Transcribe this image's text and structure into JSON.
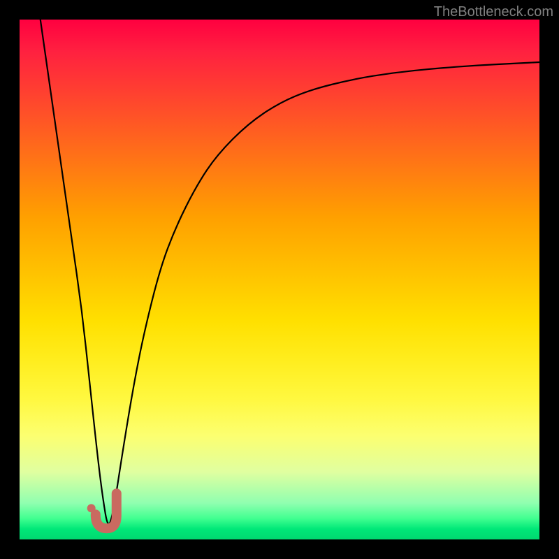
{
  "watermark": "TheBottleneck.com",
  "chart_data": {
    "type": "line",
    "title": "",
    "xlabel": "",
    "ylabel": "",
    "xlim": [
      0,
      100
    ],
    "ylim": [
      0,
      100
    ],
    "series": [
      {
        "name": "bottleneck-curve",
        "x": [
          4,
          6,
          8,
          10,
          12,
          13.5,
          15,
          16,
          17,
          18,
          20,
          22,
          24,
          27,
          30,
          34,
          38,
          44,
          50,
          56,
          64,
          72,
          80,
          88,
          96,
          100
        ],
        "y": [
          100,
          86,
          72,
          58,
          44,
          30,
          16,
          8,
          2,
          5,
          18,
          30,
          40,
          52,
          60,
          68,
          74,
          80,
          84,
          86.5,
          88.5,
          89.8,
          90.6,
          91.2,
          91.6,
          91.8
        ]
      }
    ],
    "marker": {
      "name": "optimal-point",
      "x": 16.5,
      "y": 4,
      "shape": "j-hook",
      "color": "#c96a60"
    },
    "dot": {
      "x": 13.8,
      "y": 6,
      "color": "#c96a60"
    },
    "background": {
      "type": "gradient",
      "stops": [
        {
          "pos": 0,
          "color": "#ff0040"
        },
        {
          "pos": 50,
          "color": "#ffd000"
        },
        {
          "pos": 100,
          "color": "#00d870"
        }
      ]
    }
  }
}
